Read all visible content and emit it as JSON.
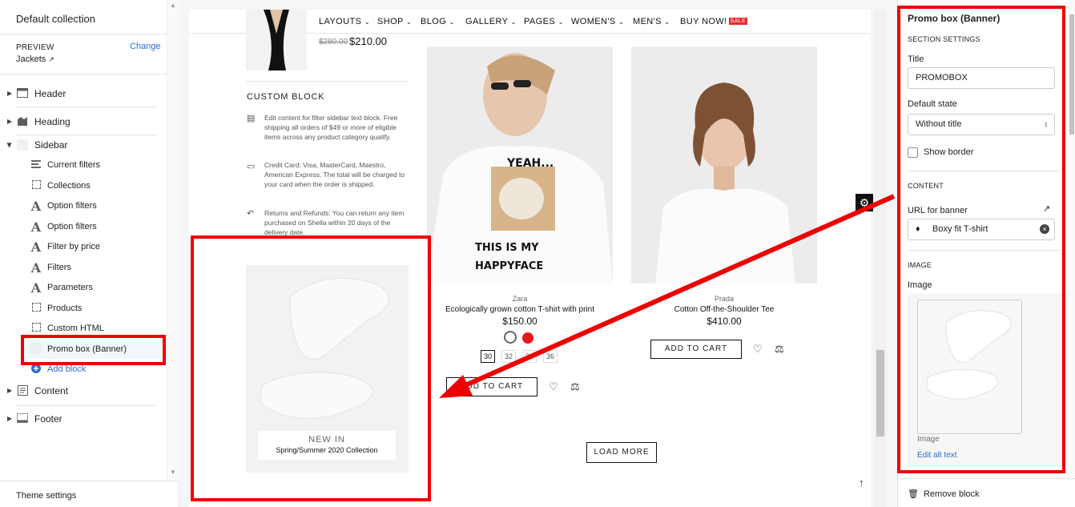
{
  "left": {
    "collection_title": "Default collection",
    "preview_label": "PREVIEW",
    "change_link": "Change",
    "preview_value": "Jackets",
    "sections": {
      "header": "Header",
      "heading": "Heading",
      "sidebar": "Sidebar",
      "content": "Content",
      "footer": "Footer"
    },
    "sidebar_items": [
      "Current filters",
      "Collections",
      "Option filters",
      "Option filters",
      "Filter by price",
      "Filters",
      "Parameters",
      "Products",
      "Custom HTML",
      "Promo box (Banner)"
    ],
    "add_block": "Add block",
    "theme_settings": "Theme settings"
  },
  "nav": {
    "items": [
      "LAYOUTS",
      "SHOP",
      "BLOG",
      "GALLERY",
      "PAGES",
      "WOMEN'S",
      "MEN'S",
      "BUY NOW!"
    ],
    "sale_badge": "SALE"
  },
  "store": {
    "top_product": {
      "old_price": "$280.00",
      "price": "$210.00"
    },
    "custom_block": {
      "title": "CUSTOM BLOCK",
      "items": [
        "Edit content for filter sidebar text block. Free shipping all orders of $49 or more of eligible items across any product category qualify.",
        "Credit Card: Visa, MasterCard, Maestro, American Express. The total will be charged to your card when the order is shipped.",
        "Returns and Refunds: You can return any item purchased on Shella within 20 days of the delivery date."
      ]
    },
    "products": [
      {
        "brand": "Zara",
        "name": "Ecologically grown cotton T-shirt with print",
        "price": "$150.00",
        "sizes": [
          "30",
          "32",
          "34",
          "36"
        ],
        "button": "ADD TO CART",
        "shirt_text": "YEAH... THIS IS MY HAPPYFACE"
      },
      {
        "brand": "Prada",
        "name": "Cotton Off-the-Shoulder Tee",
        "price": "$410.00",
        "button": "ADD TO CART"
      }
    ],
    "load_more": "LOAD MORE",
    "promo": {
      "line1": "NEW IN",
      "line2": "Spring/Summer 2020 Collection"
    }
  },
  "right": {
    "title": "Promo box (Banner)",
    "section_settings": "SECTION SETTINGS",
    "title_label": "Title",
    "title_value": "PROMOBOX",
    "default_state_label": "Default state",
    "default_state_value": "Without title",
    "show_border": "Show border",
    "content_label": "CONTENT",
    "url_label": "URL for banner",
    "url_value": "Boxy fit T-shirt",
    "image_section": "IMAGE",
    "image_label": "Image",
    "image_caption": "Image",
    "edit_alt": "Edit alt text",
    "remove_block": "Remove block"
  },
  "colors": {
    "highlight": "#ee0000",
    "link": "#2c6ecb"
  }
}
